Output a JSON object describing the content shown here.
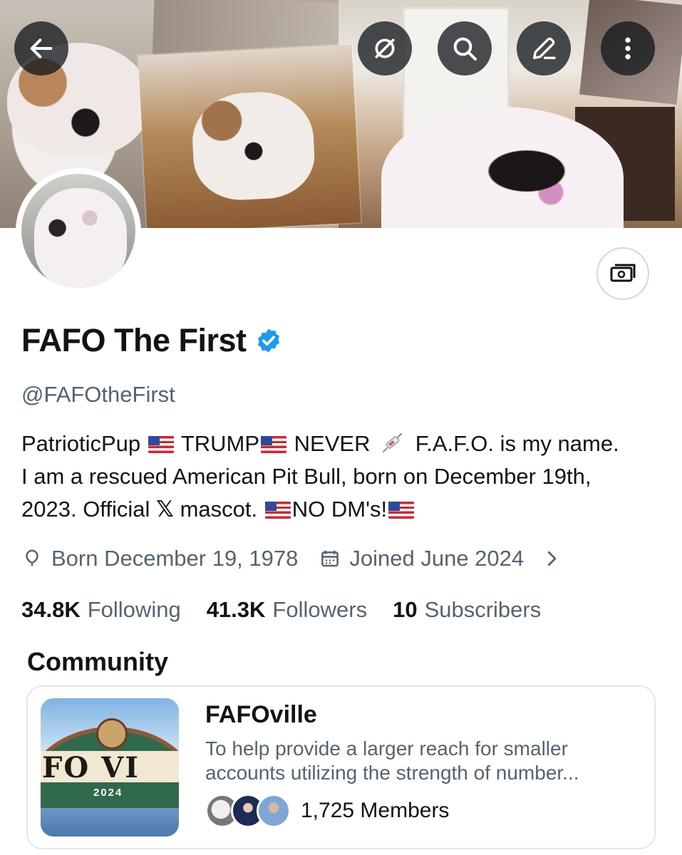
{
  "profile": {
    "name": "FAFO The First",
    "handle": "@FAFOtheFirst",
    "verified_color": "#1d9bf0",
    "bio": {
      "part1": "PatrioticPup",
      "part2": "TRUMP",
      "part3": "NEVER",
      "part4": "F.A.F.O. is my name.",
      "line2": "I am a rescued American Pit Bull, born on December 19th,",
      "part5": "2023. Official",
      "x_glyph": "𝕏",
      "part6": "mascot.",
      "part7": "NO DM's!"
    },
    "birth": "Born December 19, 1978",
    "joined": "Joined June 2024"
  },
  "stats": {
    "following_count": "34.8K",
    "following_label": "Following",
    "followers_count": "41.3K",
    "followers_label": "Followers",
    "subscribers_count": "10",
    "subscribers_label": "Subscribers"
  },
  "community": {
    "section_title": "Community",
    "name": "FAFOville",
    "description": "To help provide a larger reach for smaller accounts utilizing the strength of number...",
    "members": "1,725 Members",
    "image_text": "FO VI",
    "image_year": "2024"
  },
  "icons": {
    "back": "arrow-left-icon",
    "grok": "grok-icon",
    "search": "search-icon",
    "edit": "pencil-icon",
    "more": "more-vertical-icon",
    "subscribe": "money-icon",
    "birth": "balloon-icon",
    "joined": "calendar-icon",
    "chevron": "chevron-right-icon",
    "flag": "us-flag-icon",
    "syringe": "syringe-icon"
  }
}
